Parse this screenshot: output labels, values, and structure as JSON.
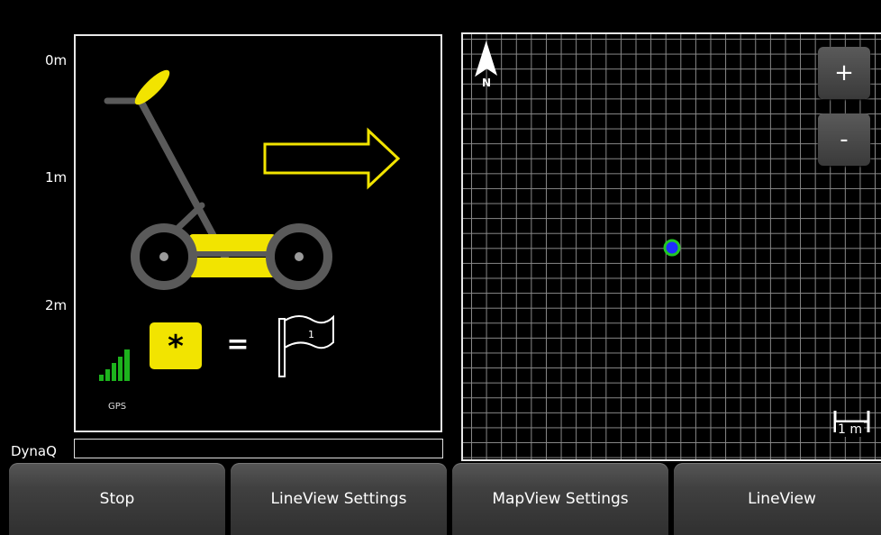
{
  "depth_axis": {
    "labels": [
      "0m",
      "1m",
      "2m"
    ]
  },
  "gps": {
    "label": "GPS",
    "signal_bars": 5,
    "signal_color": "#1db31d"
  },
  "instruction": {
    "equals": "=",
    "flag_number": "1"
  },
  "dynaq": {
    "label": "DynaQ"
  },
  "map": {
    "north_label": "N",
    "zoom_in": "+",
    "zoom_out": "-",
    "scale_label": "1 m",
    "marker_fill": "#1f2dff",
    "marker_ring": "#22c822"
  },
  "buttons": [
    "Stop",
    "LineView Settings",
    "MapView Settings",
    "LineView"
  ],
  "colors": {
    "accent": "#f2e400",
    "background": "#000000"
  }
}
